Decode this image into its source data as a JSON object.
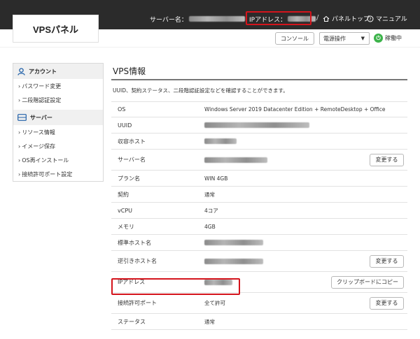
{
  "header": {
    "logo": "VPSパネル",
    "server_name_label": "サーバー名：",
    "ip_label": "IPアドレス：",
    "separator": "/",
    "panel_top": "パネルトップ",
    "manual": "マニュアル"
  },
  "toolbar": {
    "console_label": "コンソール",
    "power_select_value": "電源操作",
    "status_label": "稼働中"
  },
  "sidebar": {
    "sections": [
      {
        "title": "アカウント",
        "icon": "user-icon",
        "items": [
          "パスワード変更",
          "二段階認証設定"
        ]
      },
      {
        "title": "サーバー",
        "icon": "server-icon",
        "items": [
          "リソース情報",
          "イメージ保存",
          "OS再インストール",
          "接続許可ポート設定"
        ]
      }
    ]
  },
  "main": {
    "title": "VPS情報",
    "description": "UUID、契約ステータス、二段階認証設定などを確認することができます。",
    "rows": [
      {
        "label": "OS",
        "value": "Windows Server 2019 Datacenter Edition + RemoteDesktop + Office"
      },
      {
        "label": "UUID",
        "value": ""
      },
      {
        "label": "収容ホスト",
        "value": ""
      },
      {
        "label": "サーバー名",
        "value": "",
        "button": "変更する"
      },
      {
        "label": "プラン名",
        "value": "WIN 4GB"
      },
      {
        "label": "契約",
        "value": "通常"
      },
      {
        "label": "vCPU",
        "value": "4コア"
      },
      {
        "label": "メモリ",
        "value": "4GB"
      },
      {
        "label": "標準ホスト名",
        "value": ""
      },
      {
        "label": "逆引きホスト名",
        "value": "",
        "button": "変更する"
      },
      {
        "label": "IPアドレス",
        "value": "",
        "button": "クリップボードにコピー"
      },
      {
        "label": "接続許可ポート",
        "value": "全て許可",
        "button": "変更する"
      },
      {
        "label": "ステータス",
        "value": "通常"
      }
    ]
  },
  "colors": {
    "topbar": "#2b2b2b",
    "highlight": "#d4141c",
    "status_green": "#3cb34a"
  }
}
